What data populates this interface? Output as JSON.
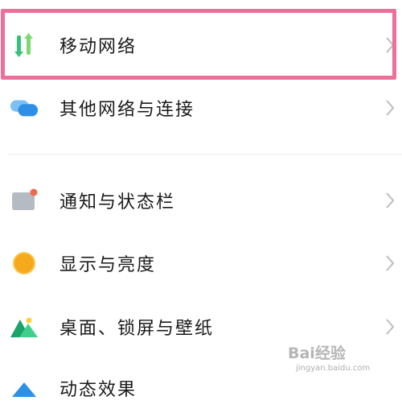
{
  "settings": {
    "items": [
      {
        "label": "移动网络",
        "icon": "mobile-data-arrows-icon"
      },
      {
        "label": "其他网络与连接",
        "icon": "connection-bubbles-icon"
      },
      {
        "label": "通知与状态栏",
        "icon": "notification-card-icon"
      },
      {
        "label": "显示与亮度",
        "icon": "brightness-sun-icon"
      },
      {
        "label": "桌面、锁屏与壁纸",
        "icon": "wallpaper-mountain-icon"
      },
      {
        "label": "动态效果",
        "icon": "dynamic-effects-icon"
      }
    ]
  },
  "watermark": {
    "brand": "Bai经验",
    "url": "jingyan.baidu.com"
  },
  "colors": {
    "highlight": "#ee6f99",
    "mobile_green": "#2fbf71",
    "blue": "#2e8fe6",
    "sun": "#f6a91c",
    "text": "#1a1a1a"
  }
}
